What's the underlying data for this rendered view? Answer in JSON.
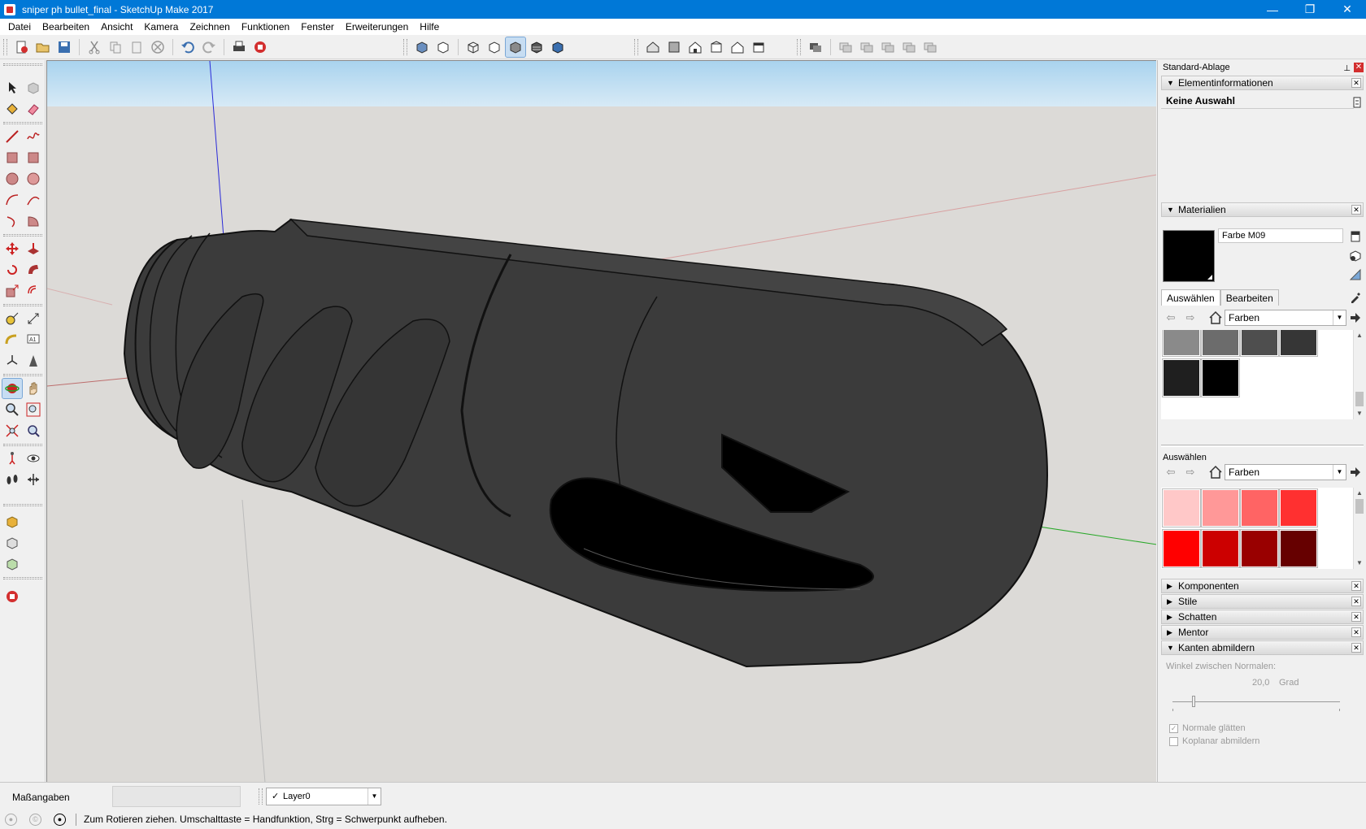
{
  "window": {
    "title": "sniper ph bullet_final - SketchUp Make 2017",
    "minimize": "—",
    "maximize": "❐",
    "close": "✕"
  },
  "menu": [
    "Datei",
    "Bearbeiten",
    "Ansicht",
    "Kamera",
    "Zeichnen",
    "Funktionen",
    "Fenster",
    "Erweiterungen",
    "Hilfe"
  ],
  "tray": {
    "title": "Standard-Ablage",
    "entity_info": {
      "header": "Elementinformationen",
      "selection": "Keine Auswahl"
    },
    "materials": {
      "header": "Materialien",
      "current_name": "Farbe M09",
      "current_color": "#000000",
      "tabs": [
        "Auswählen",
        "Bearbeiten"
      ],
      "selected_tab": "Auswählen",
      "library": "Farben",
      "swatches": [
        "#8a8a8a",
        "#6c6c6c",
        "#4e4e4e",
        "#363636",
        "#1f1f1f",
        "#000000"
      ]
    },
    "secondary": {
      "label": "Auswählen",
      "library": "Farben",
      "swatches": [
        "#ffc8c8",
        "#ff9898",
        "#ff6464",
        "#ff3030",
        "#ff0000",
        "#cc0000",
        "#990000",
        "#660000"
      ]
    },
    "collapsed_panels": [
      "Komponenten",
      "Stile",
      "Schatten",
      "Mentor"
    ],
    "soften": {
      "header": "Kanten abmildern",
      "angle_label": "Winkel zwischen Normalen:",
      "angle_value": "20,0",
      "angle_unit": "Grad",
      "smooth_normals": "Normale glätten",
      "smooth_normals_checked": true,
      "soften_coplanar": "Koplanar abmildern",
      "soften_coplanar_checked": false
    }
  },
  "bottom": {
    "measurements_label": "Maßangaben",
    "measurements_value": "",
    "layer": "Layer0"
  },
  "status": {
    "text": "Zum Rotieren ziehen. Umschalttaste = Handfunktion, Strg = Schwerpunkt aufheben."
  },
  "colors": {
    "titlebar": "#0078d7",
    "model": "#3a3a3a",
    "sky": "#bcdff2",
    "ground": "#dcdad7"
  }
}
